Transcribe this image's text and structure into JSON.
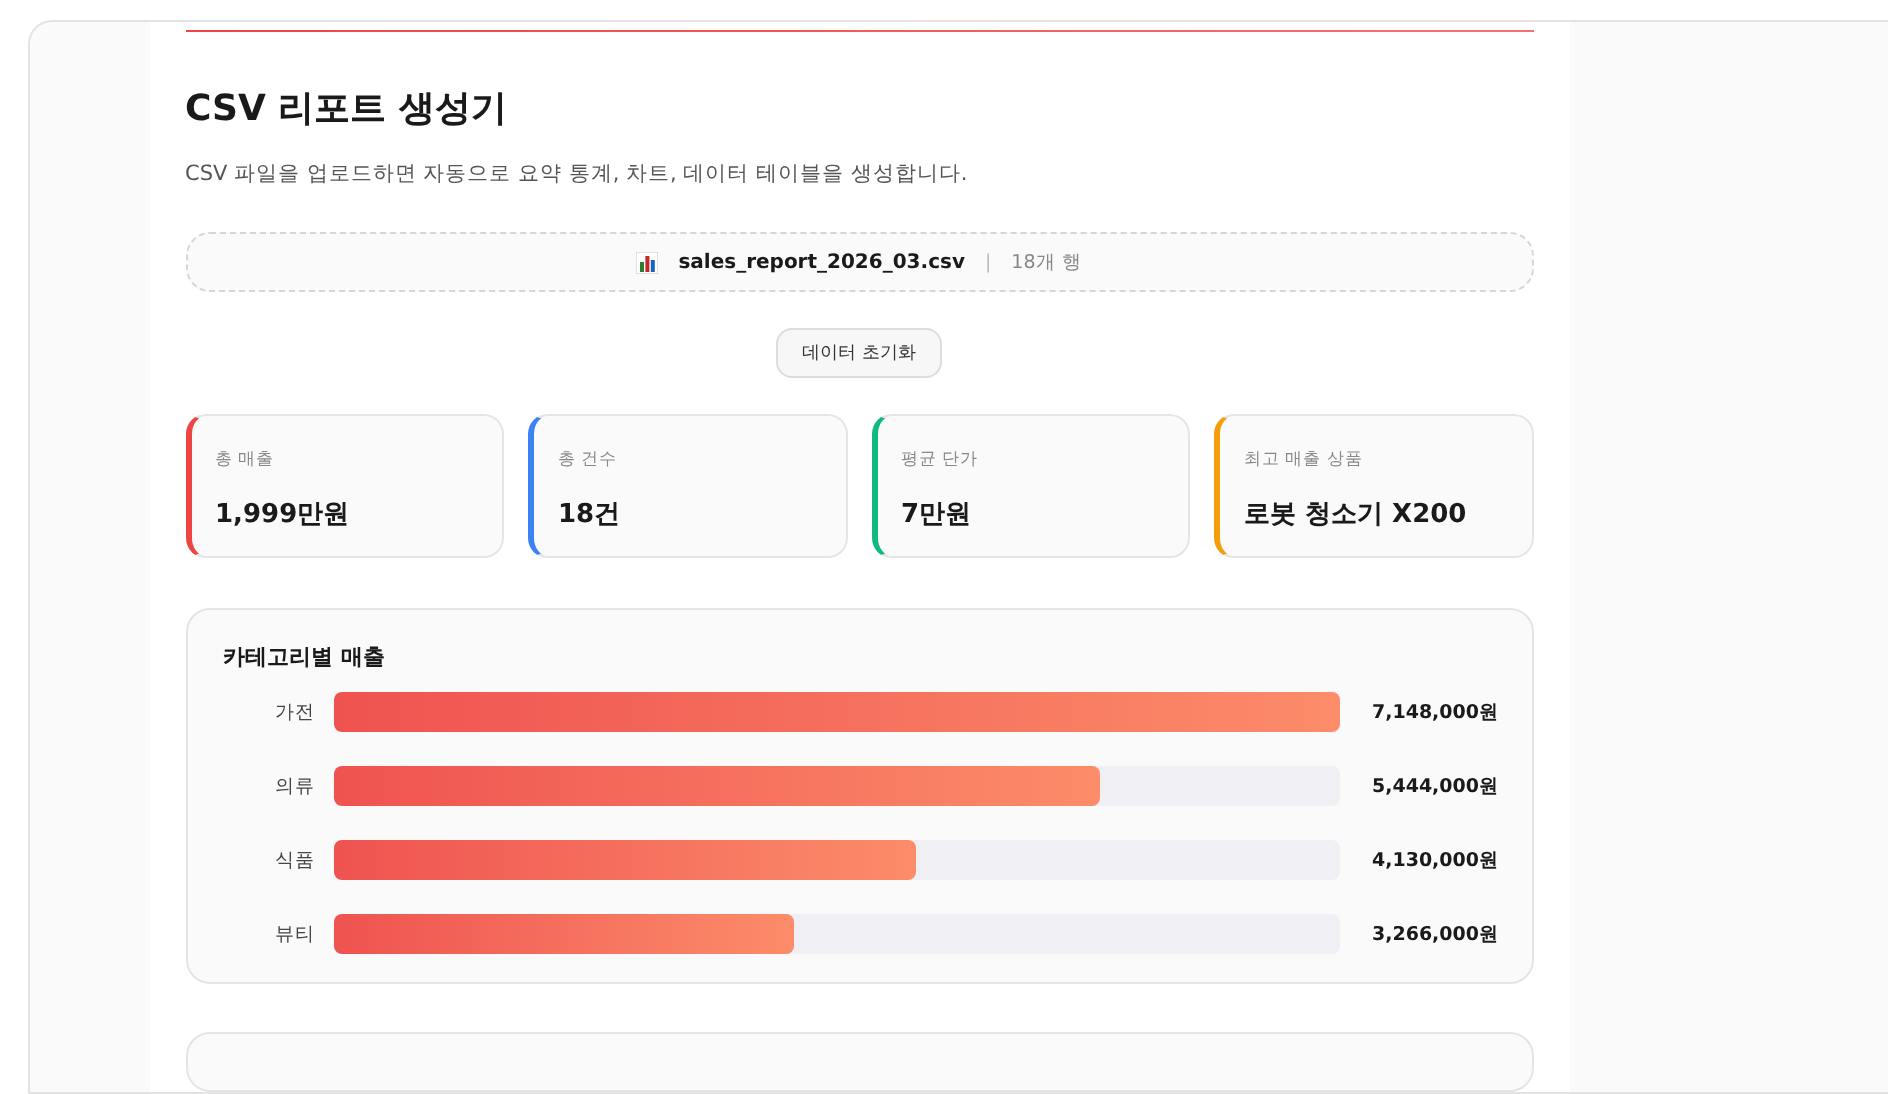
{
  "title": "CSV 리포트 생성기",
  "description": "CSV 파일을 업로드하면 자동으로 요약 통계, 차트, 데이터 테이블을 생성합니다.",
  "upload": {
    "file_name": "sales_report_2026_03.csv",
    "separator": "|",
    "row_count": "18개 행"
  },
  "reset_button": "데이터 초기화",
  "stats": [
    {
      "label": "총 매출",
      "value": "1,999만원",
      "color": "#ef4444"
    },
    {
      "label": "총 건수",
      "value": "18건",
      "color": "#3b82f6"
    },
    {
      "label": "평균 단가",
      "value": "7만원",
      "color": "#10b981"
    },
    {
      "label": "최고 매출 상품",
      "value": "로봇 청소기 X200",
      "color": "#f59e0b"
    }
  ],
  "category_chart": {
    "title": "카테고리별 매출",
    "rows": [
      {
        "label": "가전",
        "level": 1,
        "value": "7,148,000원"
      },
      {
        "label": "의류",
        "level": 0.762,
        "value": "5,444,000원"
      },
      {
        "label": "식품",
        "level": 0.578,
        "value": "4,130,000원"
      },
      {
        "label": "뷰티",
        "level": 0.457,
        "value": "3,266,000원"
      }
    ]
  }
}
